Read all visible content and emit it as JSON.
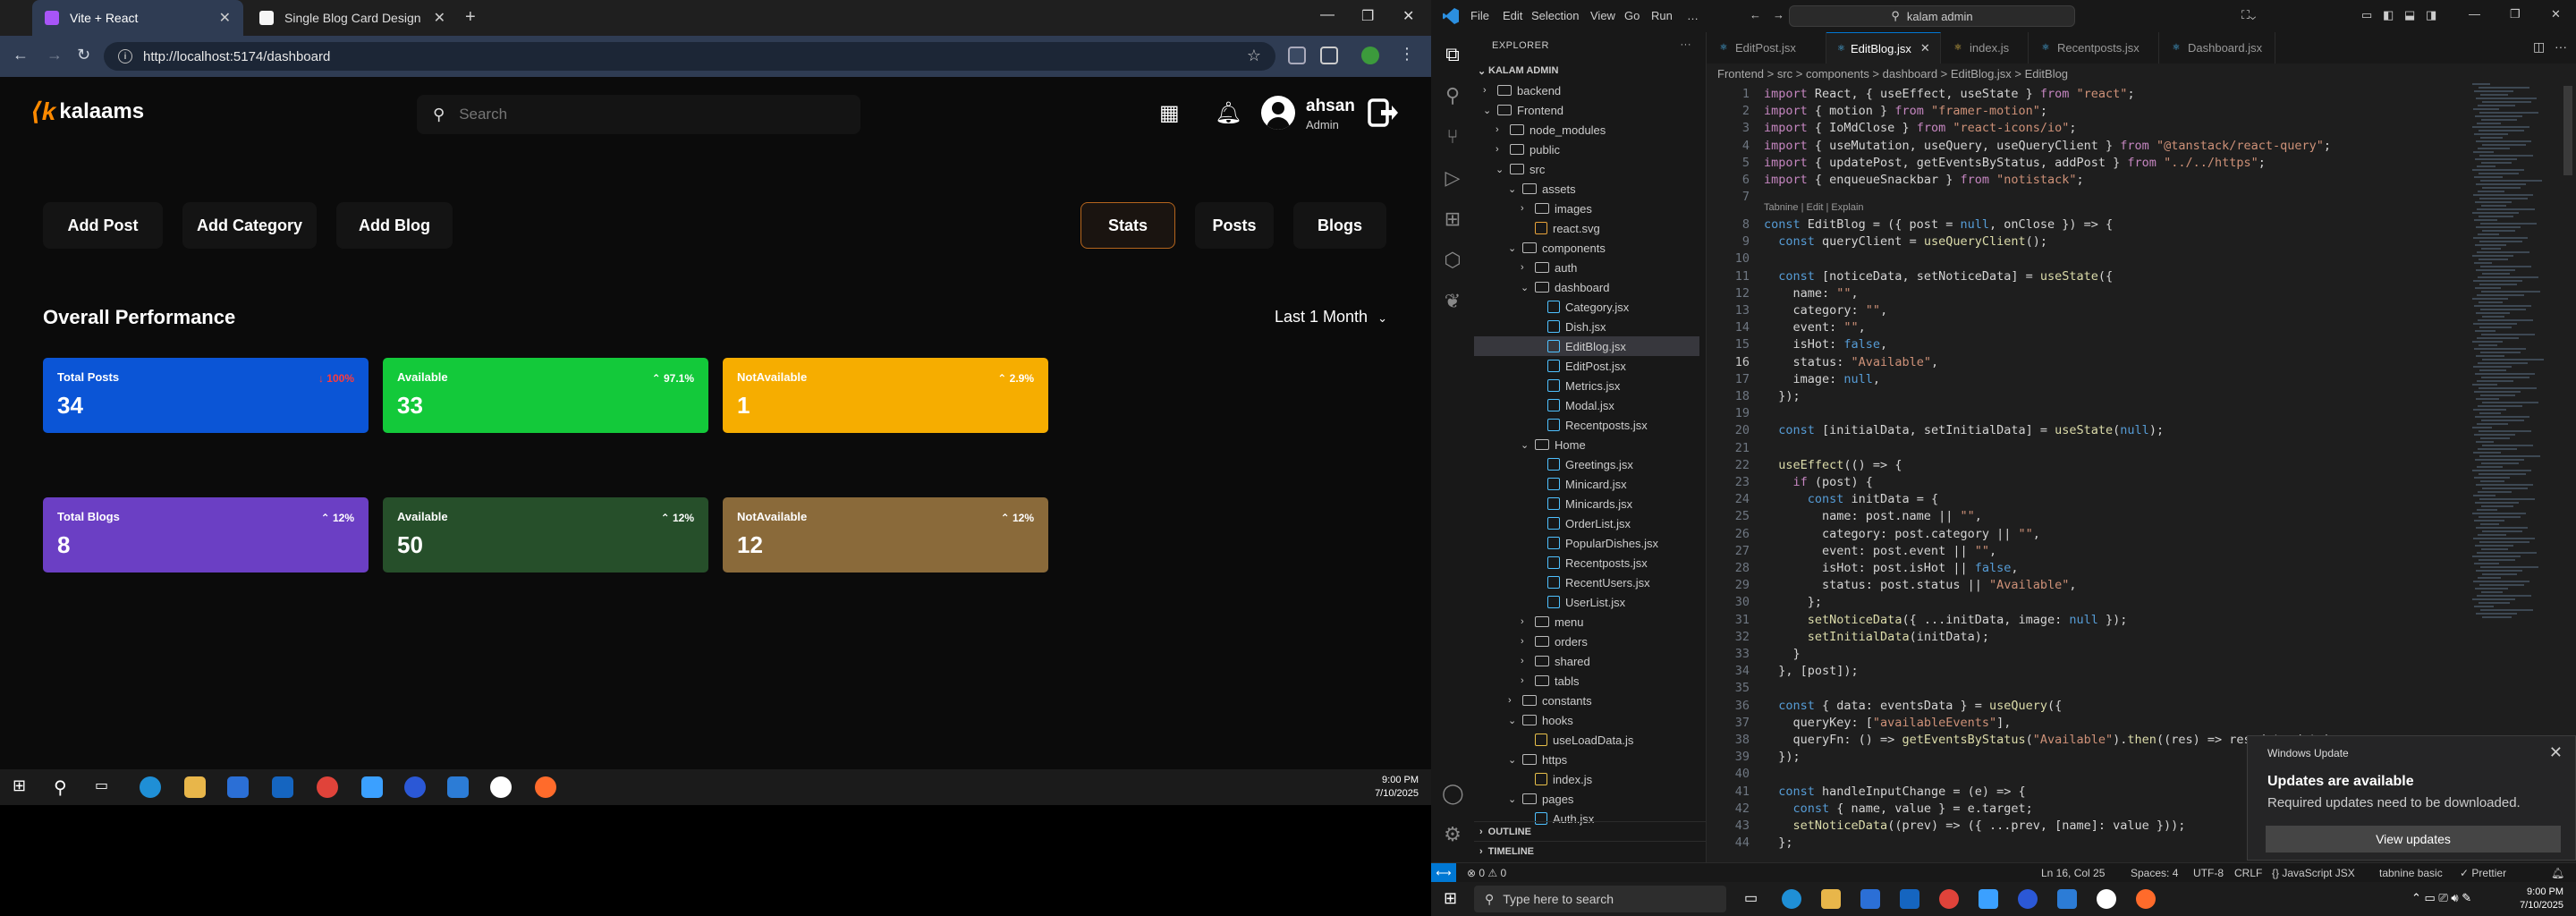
{
  "browser": {
    "tabs": [
      {
        "title": "Vite + React",
        "color": "#a855f7"
      },
      {
        "title": "Single Blog Card Design",
        "color": "#f5f5f5"
      }
    ],
    "url": "http://localhost:5174/dashboard"
  },
  "dashboard": {
    "brand": "kalaams",
    "search_placeholder": "Search",
    "user": {
      "name": "ahsan",
      "role": "Admin"
    },
    "actions_left": [
      "Add Post",
      "Add Category",
      "Add Blog"
    ],
    "actions_right": [
      "Stats",
      "Posts",
      "Blogs"
    ],
    "section_title": "Overall Performance",
    "range": "Last 1 Month",
    "post_cards": [
      {
        "label": "Total Posts",
        "value": "34",
        "change": "↓ 100%",
        "bg": "#0b55d6",
        "chg_color": "#ff3b3b"
      },
      {
        "label": "Available",
        "value": "33",
        "change": "⌃ 97.1%",
        "bg": "#13c93a",
        "chg_color": "#ffffff"
      },
      {
        "label": "NotAvailable",
        "value": "1",
        "change": "⌃ 2.9%",
        "bg": "#f6ad00",
        "chg_color": "#ffffff"
      }
    ],
    "blog_cards": [
      {
        "label": "Total Blogs",
        "value": "8",
        "change": "⌃ 12%",
        "bg": "#6b3fc4",
        "chg_color": "#ffffff"
      },
      {
        "label": "Available",
        "value": "50",
        "change": "⌃ 12%",
        "bg": "#264f2a",
        "chg_color": "#ffffff"
      },
      {
        "label": "NotAvailable",
        "value": "12",
        "change": "⌃ 12%",
        "bg": "#8a6a3a",
        "chg_color": "#ffffff"
      }
    ]
  },
  "taskbar_small": {
    "time": "9:00 PM",
    "date": "7/10/2025"
  },
  "vscode": {
    "menu": [
      "File",
      "Edit",
      "Selection",
      "View",
      "Go",
      "Run",
      "…"
    ],
    "command_center": "kalam admin",
    "explorer_title": "EXPLORER",
    "root": "KALAM ADMIN",
    "tree": [
      {
        "label": "backend",
        "depth": 0,
        "type": "folder",
        "open": false
      },
      {
        "label": "Frontend",
        "depth": 0,
        "type": "folder",
        "open": true
      },
      {
        "label": "node_modules",
        "depth": 1,
        "type": "folder",
        "open": false
      },
      {
        "label": "public",
        "depth": 1,
        "type": "folder",
        "open": false
      },
      {
        "label": "src",
        "depth": 1,
        "type": "folder",
        "open": true
      },
      {
        "label": "assets",
        "depth": 2,
        "type": "folder",
        "open": true
      },
      {
        "label": "images",
        "depth": 3,
        "type": "folder",
        "open": false
      },
      {
        "label": "react.svg",
        "depth": 3,
        "type": "svg"
      },
      {
        "label": "components",
        "depth": 2,
        "type": "folder",
        "open": true
      },
      {
        "label": "auth",
        "depth": 3,
        "type": "folder",
        "open": false
      },
      {
        "label": "dashboard",
        "depth": 3,
        "type": "folder",
        "open": true
      },
      {
        "label": "Category.jsx",
        "depth": 4,
        "type": "jsx"
      },
      {
        "label": "Dish.jsx",
        "depth": 4,
        "type": "jsx"
      },
      {
        "label": "EditBlog.jsx",
        "depth": 4,
        "type": "jsx",
        "selected": true
      },
      {
        "label": "EditPost.jsx",
        "depth": 4,
        "type": "jsx"
      },
      {
        "label": "Metrics.jsx",
        "depth": 4,
        "type": "jsx"
      },
      {
        "label": "Modal.jsx",
        "depth": 4,
        "type": "jsx"
      },
      {
        "label": "Recentposts.jsx",
        "depth": 4,
        "type": "jsx"
      },
      {
        "label": "Home",
        "depth": 3,
        "type": "folder",
        "open": true
      },
      {
        "label": "Greetings.jsx",
        "depth": 4,
        "type": "jsx"
      },
      {
        "label": "Minicard.jsx",
        "depth": 4,
        "type": "jsx"
      },
      {
        "label": "Minicards.jsx",
        "depth": 4,
        "type": "jsx"
      },
      {
        "label": "OrderList.jsx",
        "depth": 4,
        "type": "jsx"
      },
      {
        "label": "PopularDishes.jsx",
        "depth": 4,
        "type": "jsx"
      },
      {
        "label": "Recentposts.jsx",
        "depth": 4,
        "type": "jsx"
      },
      {
        "label": "RecentUsers.jsx",
        "depth": 4,
        "type": "jsx"
      },
      {
        "label": "UserList.jsx",
        "depth": 4,
        "type": "jsx"
      },
      {
        "label": "menu",
        "depth": 3,
        "type": "folder",
        "open": false
      },
      {
        "label": "orders",
        "depth": 3,
        "type": "folder",
        "open": false
      },
      {
        "label": "shared",
        "depth": 3,
        "type": "folder",
        "open": false
      },
      {
        "label": "tabls",
        "depth": 3,
        "type": "folder",
        "open": false
      },
      {
        "label": "constants",
        "depth": 2,
        "type": "folder",
        "open": false
      },
      {
        "label": "hooks",
        "depth": 2,
        "type": "folder",
        "open": true
      },
      {
        "label": "useLoadData.js",
        "depth": 3,
        "type": "js"
      },
      {
        "label": "https",
        "depth": 2,
        "type": "folder",
        "open": true
      },
      {
        "label": "index.js",
        "depth": 3,
        "type": "js"
      },
      {
        "label": "pages",
        "depth": 2,
        "type": "folder",
        "open": true
      },
      {
        "label": "Auth.jsx",
        "depth": 3,
        "type": "jsx"
      }
    ],
    "panels": [
      "OUTLINE",
      "TIMELINE"
    ],
    "tabs": [
      {
        "label": "EditPost.jsx",
        "active": false
      },
      {
        "label": "EditBlog.jsx",
        "active": true
      },
      {
        "label": "index.js",
        "active": false
      },
      {
        "label": "Recentposts.jsx",
        "active": false
      },
      {
        "label": "Dashboard.jsx",
        "active": false
      }
    ],
    "breadcrumb": "Frontend > src > components > dashboard > EditBlog.jsx > EditBlog",
    "codelens": "Tabnine | Edit | Explain",
    "current_line": 16,
    "lines": [
      "import React, { useEffect, useState } from \"react\";",
      "import { motion } from \"framer-motion\";",
      "import { IoMdClose } from \"react-icons/io\";",
      "import { useMutation, useQuery, useQueryClient } from \"@tanstack/react-query\";",
      "import { updatePost, getEventsByStatus, addPost } from \"../../https\";",
      "import { enqueueSnackbar } from \"notistack\";",
      "",
      "const EditBlog = ({ post = null, onClose }) => {",
      "  const queryClient = useQueryClient();",
      "",
      "  const [noticeData, setNoticeData] = useState({",
      "    name: \"\",",
      "    category: \"\",",
      "    event: \"\",",
      "    isHot: false,",
      "    status: \"Available\",",
      "    image: null,",
      "  });",
      "",
      "  const [initialData, setInitialData] = useState(null);",
      "",
      "  useEffect(() => {",
      "    if (post) {",
      "      const initData = {",
      "        name: post.name || \"\",",
      "        category: post.category || \"\",",
      "        event: post.event || \"\",",
      "        isHot: post.isHot || false,",
      "        status: post.status || \"Available\",",
      "      };",
      "      setNoticeData({ ...initData, image: null });",
      "      setInitialData(initData);",
      "    }",
      "  }, [post]);",
      "",
      "  const { data: eventsData } = useQuery({",
      "    queryKey: [\"availableEvents\"],",
      "    queryFn: () => getEventsByStatus(\"Available\").then((res) => res.data.data),",
      "  });",
      "",
      "  const handleInputChange = (e) => {",
      "    const { name, value } = e.target;",
      "    setNoticeData((prev) => ({ ...prev, [name]: value }));",
      "  };"
    ],
    "toast": {
      "header": "Windows Update",
      "title": "Updates are available",
      "message": "Required updates need to be downloaded.",
      "button": "View updates"
    },
    "status": {
      "problems": "⊗ 0 ⚠ 0",
      "position": "Ln 16, Col 25",
      "spaces": "Spaces: 4",
      "encoding": "UTF-8",
      "eol": "CRLF",
      "language": "{} JavaScript JSX",
      "tabnine": "tabnine basic",
      "prettier": "✓ Prettier"
    },
    "taskbar": {
      "search_placeholder": "Type here to search",
      "time": "9:00 PM",
      "date": "7/10/2025"
    }
  }
}
